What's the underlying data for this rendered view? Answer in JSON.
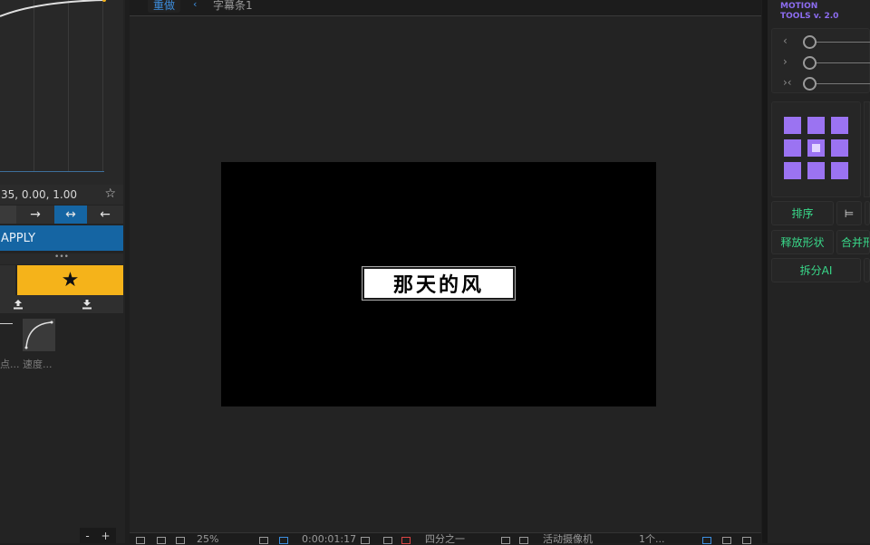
{
  "left_panel": {
    "bezier_values": "35, 0.00, 1.00",
    "direction_buttons": [
      "→",
      "↔",
      "←"
    ],
    "apply_label": "APPLY",
    "dots": "•••",
    "presets": [
      {
        "label": "点..."
      },
      {
        "label": "速度..."
      }
    ],
    "zoom_minus": "-",
    "zoom_plus": "+",
    "icons": {
      "favorite": "star-outline-icon",
      "favorite_filled": "star-icon",
      "upload": "upload-icon",
      "download": "download-icon"
    }
  },
  "viewer": {
    "tab_active": "重做",
    "tab_arrow": "‹",
    "tab_name": "字幕条1",
    "subtitle_text": "那天的风",
    "bottom_bar": {
      "zoom": "25%",
      "timecode": "0:00:01:17",
      "resolution": "四分之一",
      "camera": "活动摄像机",
      "views": "1个..."
    }
  },
  "right_panel": {
    "title_line1": "MOTION",
    "title_line2": "TOOLS v. 2.0",
    "accent_color": "#9b73f2",
    "green_color": "#39d98a",
    "slider_icons": [
      "‹",
      "›",
      "›‹"
    ],
    "buttons": {
      "sort": "排序",
      "release_shape": "释放形状",
      "merge_shape": "合并形",
      "split_ai": "拆分AI"
    }
  }
}
